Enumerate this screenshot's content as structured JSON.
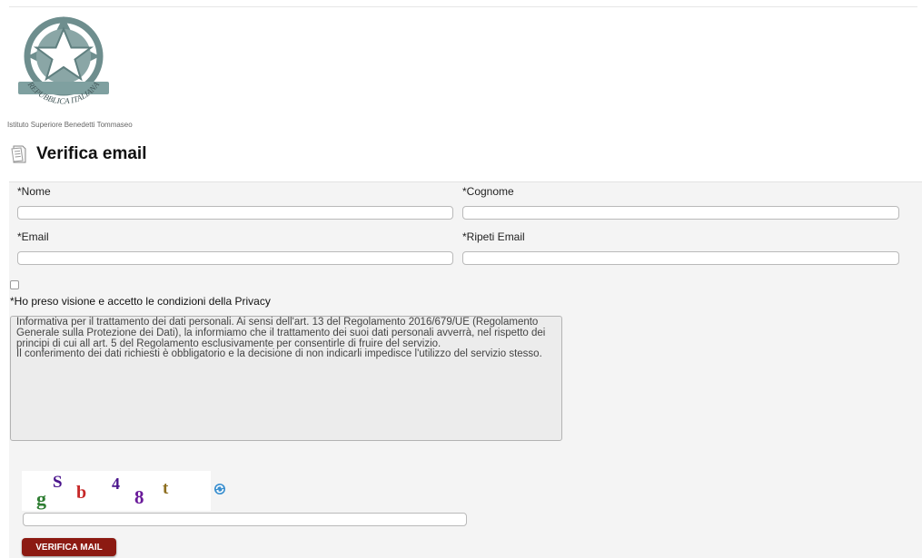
{
  "header": {
    "emblem_text": "REPUBBLICA ITALIANA",
    "school_name": "Istituto Superiore Benedetti Tommaseo",
    "page_title": "Verifica email",
    "title_icon": "document-icon"
  },
  "form": {
    "nome_label": "*Nome",
    "cognome_label": "*Cognome",
    "email_label": "*Email",
    "ripeti_email_label": "*Ripeti Email",
    "nome_value": "",
    "cognome_value": "",
    "email_value": "",
    "ripeti_email_value": ""
  },
  "privacy": {
    "checkbox_checked": false,
    "label": "*Ho preso visione e accetto le condizioni della Privacy",
    "text_line1": "Informativa per il trattamento dei dati personali. Ai sensi dell'art. 13 del Regolamento 2016/679/UE (Regolamento Generale sulla Protezione dei Dati), la informiamo che il trattamento dei suoi dati personali avverrà, nel rispetto dei principi di cui all art. 5 del Regolamento esclusivamente per consentirle di fruire del servizio.",
    "text_line2": "Il conferimento dei dati richiesti è obbligatorio e la decisione di non indicarli impedisce l'utilizzo del servizio stesso."
  },
  "captcha": {
    "chars": [
      "g",
      "S",
      "b",
      "4",
      "8",
      "t"
    ],
    "colors": [
      "#2e7d32",
      "#4a148c",
      "#c62828",
      "#4a148c",
      "#6a1b9a",
      "#8d6e1f"
    ],
    "input_value": "",
    "refresh_icon": "refresh-icon"
  },
  "submit": {
    "label": "VERIFICA MAIL",
    "color": "#8c1a12"
  }
}
